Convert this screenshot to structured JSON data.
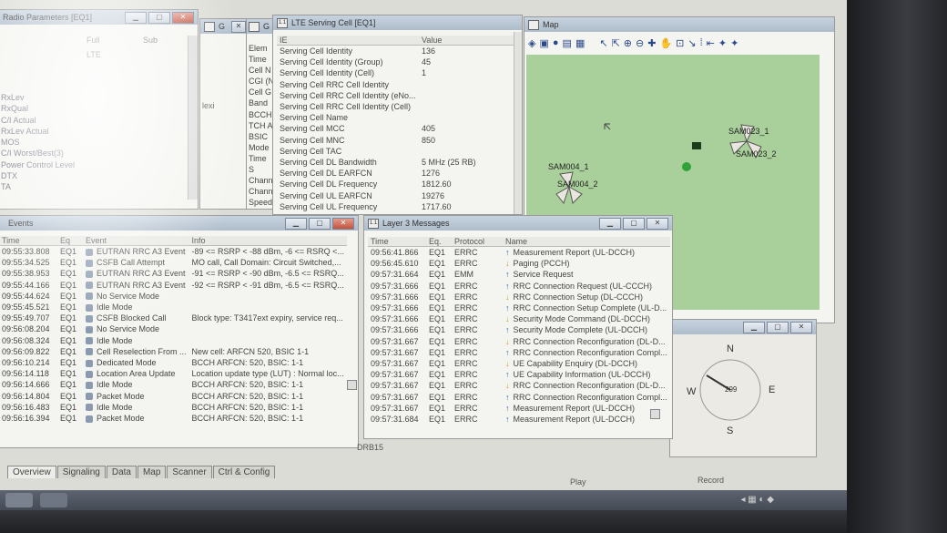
{
  "radio_params": {
    "title": "Radio Parameters [EQ1]",
    "columns": [
      "Full",
      "Sub"
    ],
    "value": "LTE",
    "labels": [
      "RxLev",
      "RxQual",
      "C/I Actual",
      "RxLev Actual",
      "MOS",
      "C/I Worst/Best(3)",
      "Power Control Level",
      "DTX",
      "TA"
    ]
  },
  "gsm_cell": {
    "title": "G",
    "labels": [
      "Elem",
      "Time",
      "Cell N",
      "CGI (N",
      "Cell G",
      "Band",
      "BCCH",
      "TCH A",
      "BSIC",
      "Mode",
      "Time S",
      "Chann",
      "Chann",
      "Speed"
    ],
    "extra": "lexi"
  },
  "lte_cell": {
    "title": "LTE Serving Cell [EQ1]",
    "col_ie": "IE",
    "col_value": "Value",
    "rows": [
      {
        "ie": "Serving Cell Identity",
        "value": "136"
      },
      {
        "ie": "Serving Cell Identity (Group)",
        "value": "45"
      },
      {
        "ie": "Serving Cell Identity (Cell)",
        "value": "1"
      },
      {
        "ie": "Serving Cell RRC Cell Identity",
        "value": ""
      },
      {
        "ie": "Serving Cell RRC Cell Identity (eNo...",
        "value": ""
      },
      {
        "ie": "Serving Cell RRC Cell Identity (Cell)",
        "value": ""
      },
      {
        "ie": "Serving Cell Name",
        "value": ""
      },
      {
        "ie": "Serving Cell MCC",
        "value": "405"
      },
      {
        "ie": "Serving Cell MNC",
        "value": "850"
      },
      {
        "ie": "Serving Cell TAC",
        "value": ""
      },
      {
        "ie": "Serving Cell DL Bandwidth",
        "value": "5 MHz (25 RB)"
      },
      {
        "ie": "Serving Cell DL EARFCN",
        "value": "1276"
      },
      {
        "ie": "Serving Cell DL Frequency",
        "value": "1812.60"
      },
      {
        "ie": "Serving Cell UL EARFCN",
        "value": "19276"
      },
      {
        "ie": "Serving Cell UL Frequency",
        "value": "1717.60"
      }
    ]
  },
  "map": {
    "title": "Map",
    "sites": [
      "SAM004_1",
      "SAM004_2",
      "SAM023_1",
      "SAM023_2"
    ]
  },
  "events": {
    "title": "Events",
    "columns": [
      "Time",
      "Eq",
      "Event",
      "Info"
    ],
    "rows": [
      {
        "time": "09:55:33.808",
        "eq": "EQ1",
        "event": "EUTRAN RRC A3 Event",
        "info": "-89 <= RSRP < -88 dBm, -6 <= RSRQ <..."
      },
      {
        "time": "09:55:34.525",
        "eq": "EQ1",
        "event": "CSFB Call Attempt",
        "info": "MO call, Call Domain: Circuit Switched,..."
      },
      {
        "time": "09:55:38.953",
        "eq": "EQ1",
        "event": "EUTRAN RRC A3 Event",
        "info": "-91 <= RSRP < -90 dBm, -6.5 <= RSRQ..."
      },
      {
        "time": "09:55:44.166",
        "eq": "EQ1",
        "event": "EUTRAN RRC A3 Event",
        "info": "-92 <= RSRP < -91 dBm, -6.5 <= RSRQ..."
      },
      {
        "time": "09:55:44.624",
        "eq": "EQ1",
        "event": "No Service Mode",
        "info": ""
      },
      {
        "time": "09:55:45.521",
        "eq": "EQ1",
        "event": "Idle Mode",
        "info": ""
      },
      {
        "time": "09:55:49.707",
        "eq": "EQ1",
        "event": "CSFB Blocked Call",
        "info": "Block type: T3417ext expiry, service req..."
      },
      {
        "time": "09:56:08.204",
        "eq": "EQ1",
        "event": "No Service Mode",
        "info": ""
      },
      {
        "time": "09:56:08.324",
        "eq": "EQ1",
        "event": "Idle Mode",
        "info": ""
      },
      {
        "time": "09:56:09.822",
        "eq": "EQ1",
        "event": "Cell Reselection From ...",
        "info": "New cell: ARFCN 520, BSIC 1-1"
      },
      {
        "time": "09:56:10.214",
        "eq": "EQ1",
        "event": "Dedicated Mode",
        "info": "BCCH ARFCN: 520, BSIC: 1-1"
      },
      {
        "time": "09:56:14.118",
        "eq": "EQ1",
        "event": "Location Area Update",
        "info": "Location update type (LUT) : Normal loc..."
      },
      {
        "time": "09:56:14.666",
        "eq": "EQ1",
        "event": "Idle Mode",
        "info": "BCCH ARFCN: 520, BSIC: 1-1"
      },
      {
        "time": "09:56:14.804",
        "eq": "EQ1",
        "event": "Packet Mode",
        "info": "BCCH ARFCN: 520, BSIC: 1-1"
      },
      {
        "time": "09:56:16.483",
        "eq": "EQ1",
        "event": "Idle Mode",
        "info": "BCCH ARFCN: 520, BSIC: 1-1"
      },
      {
        "time": "09:56:16.394",
        "eq": "EQ1",
        "event": "Packet Mode",
        "info": "BCCH ARFCN: 520, BSIC: 1-1"
      }
    ]
  },
  "layer3": {
    "title": "Layer 3 Messages",
    "columns": [
      "Time",
      "Eq.",
      "Protocol",
      "Name"
    ],
    "rows": [
      {
        "time": "09:56:41.866",
        "eq": "EQ1",
        "proto": "ERRC",
        "dir": "up",
        "name": "Measurement Report (UL-DCCH)"
      },
      {
        "time": "09:56:45.610",
        "eq": "EQ1",
        "proto": "ERRC",
        "dir": "down",
        "name": "Paging (PCCH)"
      },
      {
        "time": "09:57:31.664",
        "eq": "EQ1",
        "proto": "EMM",
        "dir": "up",
        "name": "Service Request"
      },
      {
        "time": "09:57:31.666",
        "eq": "EQ1",
        "proto": "ERRC",
        "dir": "up",
        "name": "RRC Connection Request (UL-CCCH)"
      },
      {
        "time": "09:57:31.666",
        "eq": "EQ1",
        "proto": "ERRC",
        "dir": "down",
        "name": "RRC Connection Setup (DL-CCCH)"
      },
      {
        "time": "09:57:31.666",
        "eq": "EQ1",
        "proto": "ERRC",
        "dir": "up",
        "name": "RRC Connection Setup Complete (UL-D..."
      },
      {
        "time": "09:57:31.666",
        "eq": "EQ1",
        "proto": "ERRC",
        "dir": "down",
        "name": "Security Mode Command (DL-DCCH)"
      },
      {
        "time": "09:57:31.666",
        "eq": "EQ1",
        "proto": "ERRC",
        "dir": "up",
        "name": "Security Mode Complete (UL-DCCH)"
      },
      {
        "time": "09:57:31.667",
        "eq": "EQ1",
        "proto": "ERRC",
        "dir": "down",
        "name": "RRC Connection Reconfiguration (DL-D..."
      },
      {
        "time": "09:57:31.667",
        "eq": "EQ1",
        "proto": "ERRC",
        "dir": "up",
        "name": "RRC Connection Reconfiguration Compl..."
      },
      {
        "time": "09:57:31.667",
        "eq": "EQ1",
        "proto": "ERRC",
        "dir": "down",
        "name": "UE Capability Enquiry (DL-DCCH)"
      },
      {
        "time": "09:57:31.667",
        "eq": "EQ1",
        "proto": "ERRC",
        "dir": "up",
        "name": "UE Capability Information (UL-DCCH)"
      },
      {
        "time": "09:57:31.667",
        "eq": "EQ1",
        "proto": "ERRC",
        "dir": "down",
        "name": "RRC Connection Reconfiguration (DL-D..."
      },
      {
        "time": "09:57:31.667",
        "eq": "EQ1",
        "proto": "ERRC",
        "dir": "up",
        "name": "RRC Connection Reconfiguration Compl..."
      },
      {
        "time": "09:57:31.667",
        "eq": "EQ1",
        "proto": "ERRC",
        "dir": "up",
        "name": "Measurement Report (UL-DCCH)"
      },
      {
        "time": "09:57:31.684",
        "eq": "EQ1",
        "proto": "ERRC",
        "dir": "up",
        "name": "Measurement Report (UL-DCCH)"
      }
    ]
  },
  "compass": {
    "n": "N",
    "s": "S",
    "e": "E",
    "w": "W",
    "heading": "299"
  },
  "status": {
    "drb": "DRB15",
    "play": "Play",
    "record": "Record"
  },
  "tabs": [
    "Overview",
    "Signaling",
    "Data",
    "Map",
    "Scanner",
    "Ctrl & Config"
  ],
  "colors": {
    "map_bg": "#a9d09b",
    "titlebar": "#b7c4d2",
    "close": "#c9584a",
    "arrow_up": "#2f5fb0",
    "arrow_down": "#c8952a"
  }
}
